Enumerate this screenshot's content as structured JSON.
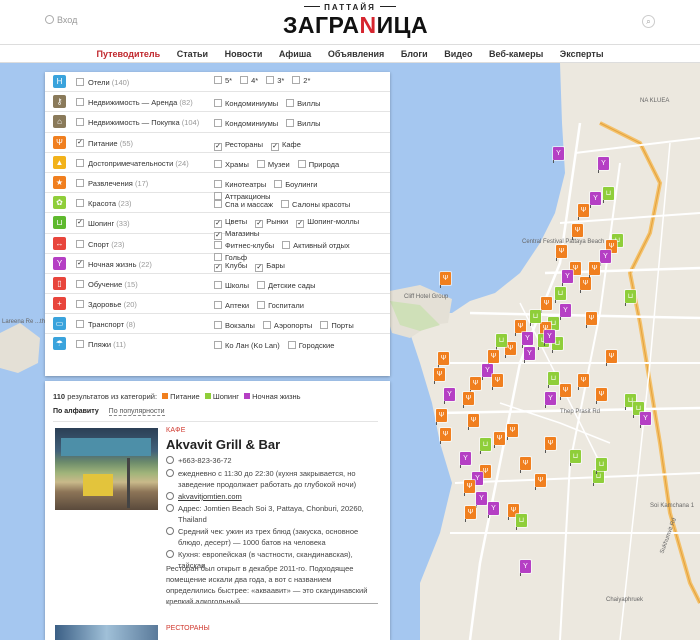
{
  "header": {
    "login_label": "Вход",
    "brand_sub": "ПАТТАЙЯ",
    "brand_main_a": "ЗАГРА",
    "brand_main_b": "N",
    "brand_main_c": "ИЦА"
  },
  "nav": {
    "items": [
      "Путеводитель",
      "Статьи",
      "Новости",
      "Афиша",
      "Объявления",
      "Блоги",
      "Видео",
      "Веб-камеры",
      "Эксперты"
    ]
  },
  "filters": {
    "categories": [
      {
        "label": "Отели",
        "count": "(140)",
        "color": "#3aa3dc",
        "icon": "hotel-icon",
        "checked": false,
        "subs": [
          {
            "label": "5*",
            "checked": false
          },
          {
            "label": "4*",
            "checked": false
          },
          {
            "label": "3*",
            "checked": false
          },
          {
            "label": "2*",
            "checked": false
          }
        ]
      },
      {
        "label": "Недвижимость — Аренда",
        "count": "(82)",
        "color": "#8a7a5a",
        "icon": "key-icon",
        "checked": false,
        "subs": [
          {
            "label": "Кондоминиумы",
            "checked": false
          },
          {
            "label": "Виллы",
            "checked": false
          }
        ]
      },
      {
        "label": "Недвижимость — Покупка",
        "count": "(104)",
        "color": "#8a7a5a",
        "icon": "house-icon",
        "checked": false,
        "subs": [
          {
            "label": "Кондоминиумы",
            "checked": false
          },
          {
            "label": "Виллы",
            "checked": false
          }
        ]
      },
      {
        "label": "Питание",
        "count": "(55)",
        "color": "#f07f1f",
        "icon": "fork-knife-icon",
        "checked": true,
        "subs": [
          {
            "label": "Рестораны",
            "checked": true
          },
          {
            "label": "Кафе",
            "checked": true
          }
        ]
      },
      {
        "label": "Достопримечательности",
        "count": "(24)",
        "color": "#f2b21b",
        "icon": "landmark-icon",
        "checked": false,
        "subs": [
          {
            "label": "Храмы",
            "checked": false
          },
          {
            "label": "Музеи",
            "checked": false
          },
          {
            "label": "Природа",
            "checked": false
          }
        ]
      },
      {
        "label": "Развлечения",
        "count": "(17)",
        "color": "#f07f1f",
        "icon": "star-icon",
        "checked": false,
        "subs": [
          {
            "label": "Кинотеатры",
            "checked": false
          },
          {
            "label": "Боулинги",
            "checked": false
          },
          {
            "label": "Аттракционы",
            "checked": false
          }
        ]
      },
      {
        "label": "Красота",
        "count": "(23)",
        "color": "#8fce3a",
        "icon": "flower-icon",
        "checked": false,
        "subs": [
          {
            "label": "Спа и массаж",
            "checked": false
          },
          {
            "label": "Салоны красоты",
            "checked": false
          }
        ]
      },
      {
        "label": "Шопинг",
        "count": "(33)",
        "color": "#5fb92e",
        "icon": "cart-icon",
        "checked": true,
        "subs": [
          {
            "label": "Цветы",
            "checked": true
          },
          {
            "label": "Рынки",
            "checked": true
          },
          {
            "label": "Шопинг-моллы",
            "checked": true
          },
          {
            "label": "Магазины",
            "checked": true
          }
        ]
      },
      {
        "label": "Спорт",
        "count": "(23)",
        "color": "#e8453c",
        "icon": "dumbbell-icon",
        "checked": false,
        "subs": [
          {
            "label": "Фитнес-клубы",
            "checked": false
          },
          {
            "label": "Активный отдых",
            "checked": false
          },
          {
            "label": "Гольф",
            "checked": false
          }
        ]
      },
      {
        "label": "Ночная жизнь",
        "count": "(22)",
        "color": "#b53fc4",
        "icon": "cocktail-icon",
        "checked": true,
        "subs": [
          {
            "label": "Клубы",
            "checked": true
          },
          {
            "label": "Бары",
            "checked": true
          }
        ]
      },
      {
        "label": "Обучение",
        "count": "(15)",
        "color": "#e8453c",
        "icon": "book-icon",
        "checked": false,
        "subs": [
          {
            "label": "Школы",
            "checked": false
          },
          {
            "label": "Детские сады",
            "checked": false
          }
        ]
      },
      {
        "label": "Здоровье",
        "count": "(20)",
        "color": "#e8453c",
        "icon": "health-cross-icon",
        "checked": false,
        "subs": [
          {
            "label": "Аптеки",
            "checked": false
          },
          {
            "label": "Госпитали",
            "checked": false
          }
        ]
      },
      {
        "label": "Транспорт",
        "count": "(8)",
        "color": "#3aa3dc",
        "icon": "car-icon",
        "checked": false,
        "subs": [
          {
            "label": "Вокзалы",
            "checked": false
          },
          {
            "label": "Аэропорты",
            "checked": false
          },
          {
            "label": "Порты",
            "checked": false
          }
        ]
      },
      {
        "label": "Пляжи",
        "count": "(11)",
        "color": "#3aa3dc",
        "icon": "beach-icon",
        "checked": false,
        "subs": [
          {
            "label": "Ко Лан (Ko Lan)",
            "checked": false
          },
          {
            "label": "Городские",
            "checked": false
          }
        ]
      }
    ]
  },
  "results": {
    "count": "110",
    "summary_text": "результатов из категорий:",
    "legend": [
      {
        "label": "Питание",
        "color": "#f07f1f"
      },
      {
        "label": "Шопинг",
        "color": "#8fce3a"
      },
      {
        "label": "Ночная жизнь",
        "color": "#b53fc4"
      }
    ],
    "sort_alpha": "По алфавиту",
    "sort_popular": "По популярности",
    "item": {
      "type": "Кафе",
      "name": "Akvavit Grill & Bar",
      "phone": "+663-823-36-72",
      "hours": "ежедневно с 11:30 до 22:30 (кухня закрывается, но заведение продолжает работать до глубокой ночи)",
      "website": "akvavitjomtien.com",
      "address": "Адрес: Jomtien Beach Soi 3, Pattaya, Chonburi, 20260, Thailand",
      "check": "Средний чек: ужин из трех блюд (закуска, основное блюдо, десерт) — 1000 батов на человека",
      "cuisine": "Кухня: европейская (в частности, скандинавская), тайская",
      "description": "Ресторан был открыт в декабре 2011-го. Подходящее помещение искали два года, а вот с названием определились быстрее: «акваавит» — это скандинавский крепкий алкогольный"
    },
    "item2_type": "Рестораны"
  },
  "map": {
    "labels": [
      "NA KLUEA",
      "Central Festival Pattaya Beach",
      "Cliff Hotel Group",
      "Lareena Re ...the sea Kol",
      "Thep Prasit Rd",
      "Sukhumvit Rd",
      "Chaiyaphruek",
      "Soi Kamchana 1"
    ],
    "flag_colors": {
      "food": "#f07f1f",
      "shop": "#8fce3a",
      "night": "#b53fc4"
    }
  }
}
